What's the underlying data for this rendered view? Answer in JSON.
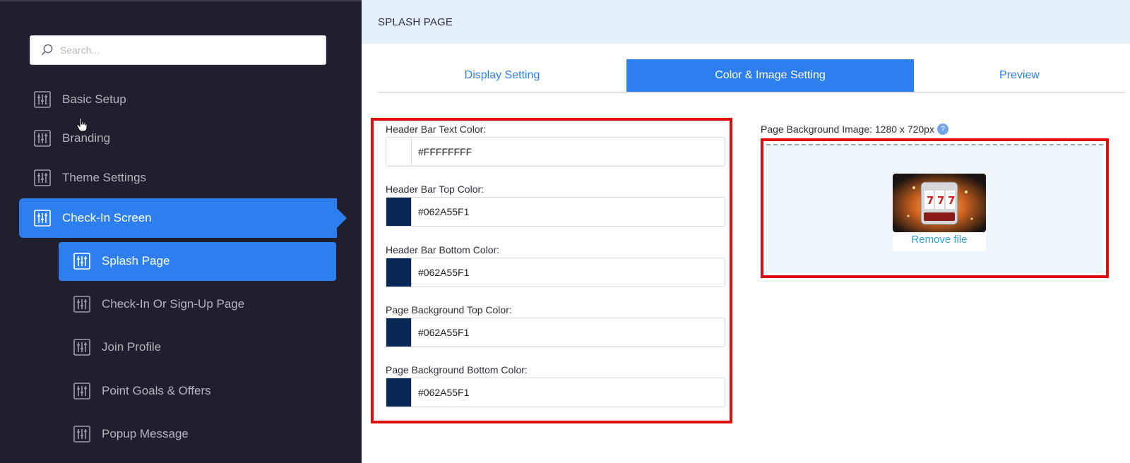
{
  "sidebar": {
    "search": {
      "placeholder": "Search..."
    },
    "items": [
      {
        "label": "Basic Setup"
      },
      {
        "label": "Branding"
      },
      {
        "label": "Theme Settings"
      },
      {
        "label": "Check-In Screen"
      }
    ],
    "subitems": [
      {
        "label": "Splash Page"
      },
      {
        "label": "Check-In Or Sign-Up Page"
      },
      {
        "label": "Join Profile"
      },
      {
        "label": "Point Goals & Offers"
      },
      {
        "label": "Popup Message"
      }
    ]
  },
  "main": {
    "title": "SPLASH PAGE",
    "tabs": [
      {
        "label": "Display Setting"
      },
      {
        "label": "Color & Image Setting"
      },
      {
        "label": "Preview"
      }
    ],
    "fields": [
      {
        "label": "Header Bar Text Color:",
        "value": "#FFFFFFFF",
        "swatch": "#FFFFFF"
      },
      {
        "label": "Header Bar Top Color:",
        "value": "#062A55F1",
        "swatch": "#062A55"
      },
      {
        "label": "Header Bar Bottom Color:",
        "value": "#062A55F1",
        "swatch": "#062A55"
      },
      {
        "label": "Page Background Top Color:",
        "value": "#062A55F1",
        "swatch": "#062A55"
      },
      {
        "label": "Page Background Bottom Color:",
        "value": "#062A55F1",
        "swatch": "#062A55"
      }
    ],
    "image": {
      "label": "Page Background Image: 1280 x 720px",
      "help": "?",
      "remove_label": "Remove file"
    }
  },
  "colors": {
    "accent": "#2D7FF0",
    "sidebar_bg": "#1F1F2E",
    "highlight": "#E00D0D"
  }
}
